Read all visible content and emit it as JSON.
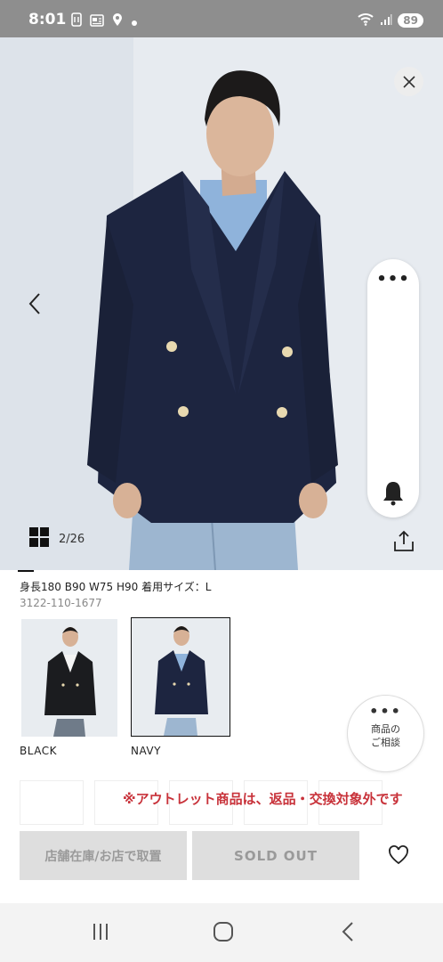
{
  "status_bar": {
    "time": "8:01",
    "battery": "89",
    "icons": [
      "nfc-icon",
      "news-icon",
      "location-icon",
      "dot-icon",
      "wifi-icon",
      "signal-icon"
    ]
  },
  "gallery": {
    "counter": "2/26",
    "icons": [
      "close-icon",
      "chevron-left-icon",
      "more-dots-icon",
      "bell-icon",
      "grid-icon",
      "share-icon"
    ],
    "more_dots": "•••"
  },
  "product": {
    "size_info": "身長180 B90 W75 H90 着用サイズ：L",
    "code": "3122-110-1677",
    "colors": [
      {
        "label": "BLACK",
        "selected": false,
        "jacket_color": "#1b1c1f"
      },
      {
        "label": "NAVY",
        "selected": true,
        "jacket_color": "#1d2540"
      }
    ]
  },
  "consult": {
    "dots": "•••",
    "line1": "商品の",
    "line2": "ご相談"
  },
  "notice": "※アウトレット商品は、返品・交換対象外です",
  "actions": {
    "store_label": "店舗在庫/お店で取置",
    "sold_out_label": "SOLD OUT"
  },
  "colors": {
    "notice": "#c8323a",
    "disabled_button": "#dedede",
    "navy_jacket": "#1d2540"
  }
}
